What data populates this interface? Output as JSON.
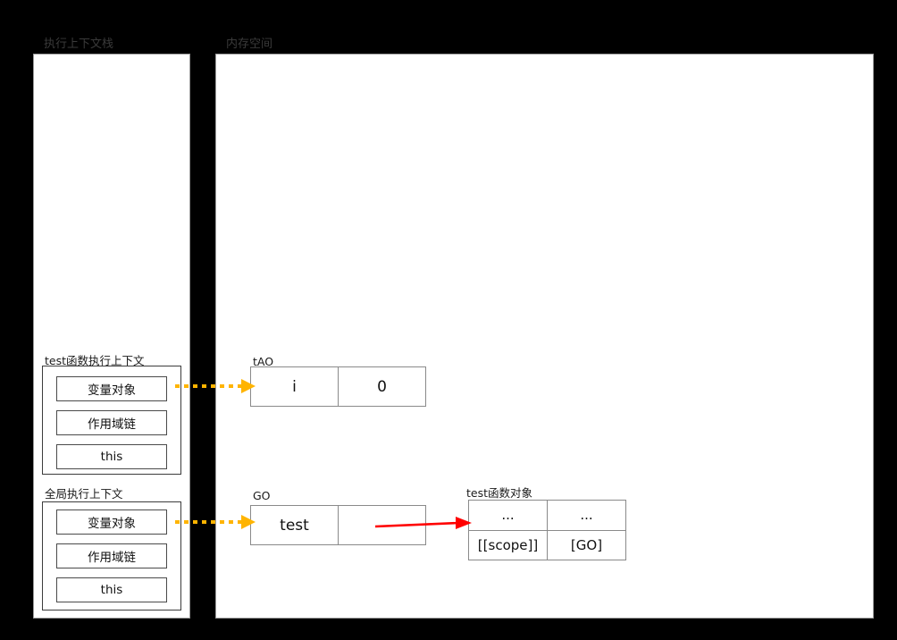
{
  "panels": {
    "stack": {
      "label": "执行上下文栈"
    },
    "memory": {
      "label": "内存空间"
    }
  },
  "execution_contexts": [
    {
      "name": "test-function-context",
      "label": "test函数执行上下文",
      "slots": [
        "变量对象",
        "作用域链",
        "this"
      ]
    },
    {
      "name": "global-context",
      "label": "全局执行上下文",
      "slots": [
        "变量对象",
        "作用域链",
        "this"
      ]
    }
  ],
  "memory_objects": [
    {
      "name": "tAO",
      "label": "tAO",
      "rows": [
        [
          "i",
          "0"
        ]
      ]
    },
    {
      "name": "GO",
      "label": "GO",
      "rows": [
        [
          "test",
          ""
        ]
      ]
    },
    {
      "name": "test-function-object",
      "label": "test函数对象",
      "rows": [
        [
          "...",
          "..."
        ],
        [
          "[[scope]]",
          "[GO]"
        ]
      ]
    }
  ],
  "arrows": [
    {
      "name": "test-vo-to-tao",
      "style": "dotted",
      "color": "#ffb400",
      "from": "变量对象",
      "to": "tAO"
    },
    {
      "name": "global-vo-to-go",
      "style": "dotted",
      "color": "#ffb400",
      "from": "变量对象",
      "to": "GO"
    },
    {
      "name": "go-test-to-function-object",
      "style": "solid",
      "color": "#ff0000",
      "from": "test",
      "to": "test函数对象"
    }
  ],
  "colors": {
    "background": "#000000",
    "panel_background": "#ffffff",
    "panel_border": "#9a9a9a",
    "dotted_arrow": "#ffb400",
    "solid_arrow": "#ff0000",
    "panel_label_text": "#3a3a3a",
    "body_text": "#111111"
  }
}
